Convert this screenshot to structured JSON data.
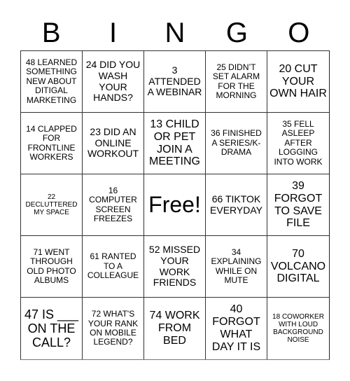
{
  "header": {
    "letters": [
      "B",
      "I",
      "N",
      "G",
      "O"
    ]
  },
  "cells": [
    "48 LEARNED SOMETHING NEW ABOUT DITIGAL MARKETING",
    "24 DID YOU WASH YOUR HANDS?",
    "3 ATTENDED A WEBINAR",
    "25 DIDN’T SET ALARM FOR THE MORNING",
    "20 CUT YOUR OWN HAIR",
    "14 CLAPPED FOR FRONTLINE WORKERS",
    "23 DID AN ONLINE WORKOUT",
    "13 CHILD OR PET JOIN A MEETING",
    "36 FINISHED A SERIES/K-DRAMA",
    "35 FELL ASLEEP AFTER LOGGING INTO WORK",
    "22 DECLUTTERED MY SPACE",
    "16 COMPUTER SCREEN FREEZES",
    "Free!",
    "66 TIKTOK EVERYDAY",
    "39 FORGOT TO SAVE FILE",
    "71 WENT THROUGH OLD PHOTO ALBUMS",
    "61 RANTED TO A COLLEAGUE",
    "52 MISSED YOUR WORK FRIENDS",
    "34 EXPLAINING WHILE ON MUTE",
    "70 VOLCANO DIGITAL",
    "47 IS ___ ON THE CALL?",
    "72 WHAT'S YOUR RANK ON MOBILE LEGEND?",
    "74 WORK FROM BED",
    "40 FORGOT WHAT DAY IT IS",
    "18 COWORKER WITH LOUD BACKGROUND NOISE"
  ]
}
